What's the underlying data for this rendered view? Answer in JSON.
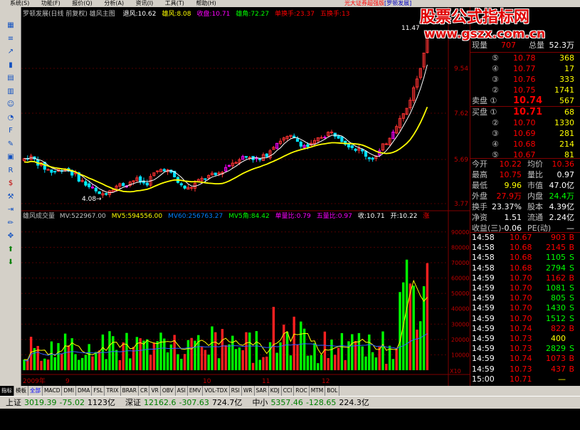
{
  "menu": {
    "items": [
      "系统(S)",
      "功能(F)",
      "报价(Q)",
      "分析(A)",
      "资讯(I)",
      "工具(T)",
      "帮助(H)"
    ],
    "title_prefix": "光大证券超强版",
    "title_stock": "[罗顿发展]"
  },
  "watermark": {
    "line1": "股票公式指标网",
    "line2": "www.gszx.com.cn"
  },
  "main_chart": {
    "header": "罗顿发展(日线 前复权) 雄风主图",
    "indicators": [
      {
        "label": "退风:10.62",
        "color": "#ffffff"
      },
      {
        "label": "雄风:8.08",
        "color": "#ffff00"
      },
      {
        "label": "收盘:10.71",
        "color": "#ff00ff"
      },
      {
        "label": "雄角:72.27",
        "color": "#00ff00"
      },
      {
        "label": "单换手:23.37",
        "color": "#ff0000"
      },
      {
        "label": "五换手:13",
        "color": "#ff0000"
      }
    ],
    "price_axis": [
      "9.54",
      "7.62",
      "5.69",
      "3.77"
    ],
    "high_label": "11.47",
    "low_label": "4.08"
  },
  "volume_chart": {
    "header": "雄风成交量",
    "indicators": [
      {
        "label": "MV:522967.00",
        "color": "#c0c0c0"
      },
      {
        "label": "MV5:594556.00",
        "color": "#ffff00"
      },
      {
        "label": "MV60:256763.27",
        "color": "#0080ff"
      },
      {
        "label": "MV5角:84.42",
        "color": "#00ff00"
      },
      {
        "label": "单量比:0.79",
        "color": "#ff00ff"
      },
      {
        "label": "五量比:0.97",
        "color": "#ff00ff"
      },
      {
        "label": "收:10.71",
        "color": "#ffffff"
      },
      {
        "label": "开:10.22",
        "color": "#ffffff"
      },
      {
        "label": "涨",
        "color": "#ff0000"
      }
    ],
    "vol_axis": [
      "90000",
      "80000",
      "70000",
      "60000",
      "50000",
      "40000",
      "30000",
      "20000",
      "10000"
    ],
    "unit": "X10"
  },
  "x_axis": {
    "labels": [
      "2009年",
      "9",
      "10",
      "11",
      "12"
    ]
  },
  "quote": {
    "volume_label": "现量",
    "volume_value": "707",
    "total_label": "总量",
    "total_value": "52.3万",
    "sells": [
      {
        "num": "⑤",
        "price": "10.78",
        "qty": "368"
      },
      {
        "num": "④",
        "price": "10.77",
        "qty": "17"
      },
      {
        "num": "③",
        "price": "10.76",
        "qty": "333"
      },
      {
        "num": "②",
        "price": "10.75",
        "qty": "1741"
      },
      {
        "num": "卖盘 ①",
        "price": "10.74",
        "qty": "567"
      }
    ],
    "buys": [
      {
        "num": "买盘 ①",
        "price": "10.71",
        "qty": "68"
      },
      {
        "num": "②",
        "price": "10.70",
        "qty": "1330"
      },
      {
        "num": "③",
        "price": "10.69",
        "qty": "281"
      },
      {
        "num": "④",
        "price": "10.68",
        "qty": "214"
      },
      {
        "num": "⑤",
        "price": "10.67",
        "qty": "81"
      }
    ],
    "stats": [
      [
        {
          "l": "今开",
          "v": "10.22",
          "c": "#ff0000"
        },
        {
          "l": "均价",
          "v": "10.36",
          "c": "#ff0000"
        }
      ],
      [
        {
          "l": "最高",
          "v": "10.75",
          "c": "#ff0000"
        },
        {
          "l": "量比",
          "v": "0.97",
          "c": "#ffffff"
        }
      ],
      [
        {
          "l": "最低",
          "v": "9.96",
          "c": "#ffff00"
        },
        {
          "l": "市值",
          "v": "47.0亿",
          "c": "#ffffff"
        }
      ],
      [
        {
          "l": "外盘",
          "v": "27.9万",
          "c": "#ff0000"
        },
        {
          "l": "内盘",
          "v": "24.4万",
          "c": "#00ff00"
        }
      ],
      [
        {
          "l": "换手",
          "v": "23.37%",
          "c": "#ffffff"
        },
        {
          "l": "股本",
          "v": "4.39亿",
          "c": "#ffffff"
        }
      ],
      [
        {
          "l": "净资",
          "v": "1.51",
          "c": "#ffffff"
        },
        {
          "l": "流通",
          "v": "2.24亿",
          "c": "#ffffff"
        }
      ],
      [
        {
          "l": "收益(三)",
          "v": "-0.06",
          "c": "#ffffff"
        },
        {
          "l": "PE(动)",
          "v": "—",
          "c": "#ffffff"
        }
      ]
    ],
    "ticks": [
      {
        "t": "14:58",
        "p": "10.67",
        "v": "903",
        "s": "B"
      },
      {
        "t": "14:58",
        "p": "10.68",
        "v": "2145",
        "s": "B"
      },
      {
        "t": "14:58",
        "p": "10.68",
        "v": "1105",
        "s": "S"
      },
      {
        "t": "14:58",
        "p": "10.68",
        "v": "2794",
        "s": "S"
      },
      {
        "t": "14:59",
        "p": "10.70",
        "v": "1162",
        "s": "B"
      },
      {
        "t": "14:59",
        "p": "10.70",
        "v": "1081",
        "s": "S"
      },
      {
        "t": "14:59",
        "p": "10.70",
        "v": "805",
        "s": "S"
      },
      {
        "t": "14:59",
        "p": "10.70",
        "v": "1430",
        "s": "S"
      },
      {
        "t": "14:59",
        "p": "10.70",
        "v": "1512",
        "s": "S"
      },
      {
        "t": "14:59",
        "p": "10.74",
        "v": "822",
        "s": "B"
      },
      {
        "t": "14:59",
        "p": "10.73",
        "v": "400",
        "s": ""
      },
      {
        "t": "14:59",
        "p": "10.73",
        "v": "2829",
        "s": "S"
      },
      {
        "t": "14:59",
        "p": "10.74",
        "v": "1073",
        "s": "B"
      },
      {
        "t": "14:59",
        "p": "10.73",
        "v": "437",
        "s": "B"
      },
      {
        "t": "15:00",
        "p": "10.71",
        "v": "—",
        "s": ""
      }
    ]
  },
  "tabs": [
    "指标",
    "模板",
    "全部",
    "MACD",
    "DMI",
    "DMA",
    "FSL",
    "TRIX",
    "BRAR",
    "CR",
    "VR",
    "OBV",
    "ASI",
    "EMV",
    "VOL-TDX",
    "RSI",
    "WR",
    "SAR",
    "KDJ",
    "CCI",
    "ROC",
    "MTM",
    "BOL"
  ],
  "status": [
    {
      "name": "上证",
      "val": "3019.39",
      "chg": "-75.02",
      "amt": "1123亿"
    },
    {
      "name": "深证",
      "val": "12162.6",
      "chg": "-307.63",
      "amt": "724.7亿"
    },
    {
      "name": "中小",
      "val": "5357.46",
      "chg": "-128.65",
      "amt": "224.3亿"
    }
  ],
  "colors": {
    "up": "#ff3232",
    "down": "#00ff00",
    "ma_yellow": "#ffff00",
    "ma_white": "#ffffff",
    "ma_blue": "#3060ff",
    "grid": "#800000"
  },
  "tool_icons": [
    "grid-icon",
    "list-icon",
    "chart-icon",
    "bar-chart-icon",
    "table-icon",
    "calc-icon",
    "people-icon",
    "pie-icon",
    "f10-icon",
    "edit-icon",
    "calendar-icon",
    "rsi-icon",
    "dollar-icon",
    "wrench-icon",
    "export-icon",
    "pencil-icon",
    "crosshair-icon",
    "up-arrow-icon",
    "down-arrow-icon"
  ]
}
